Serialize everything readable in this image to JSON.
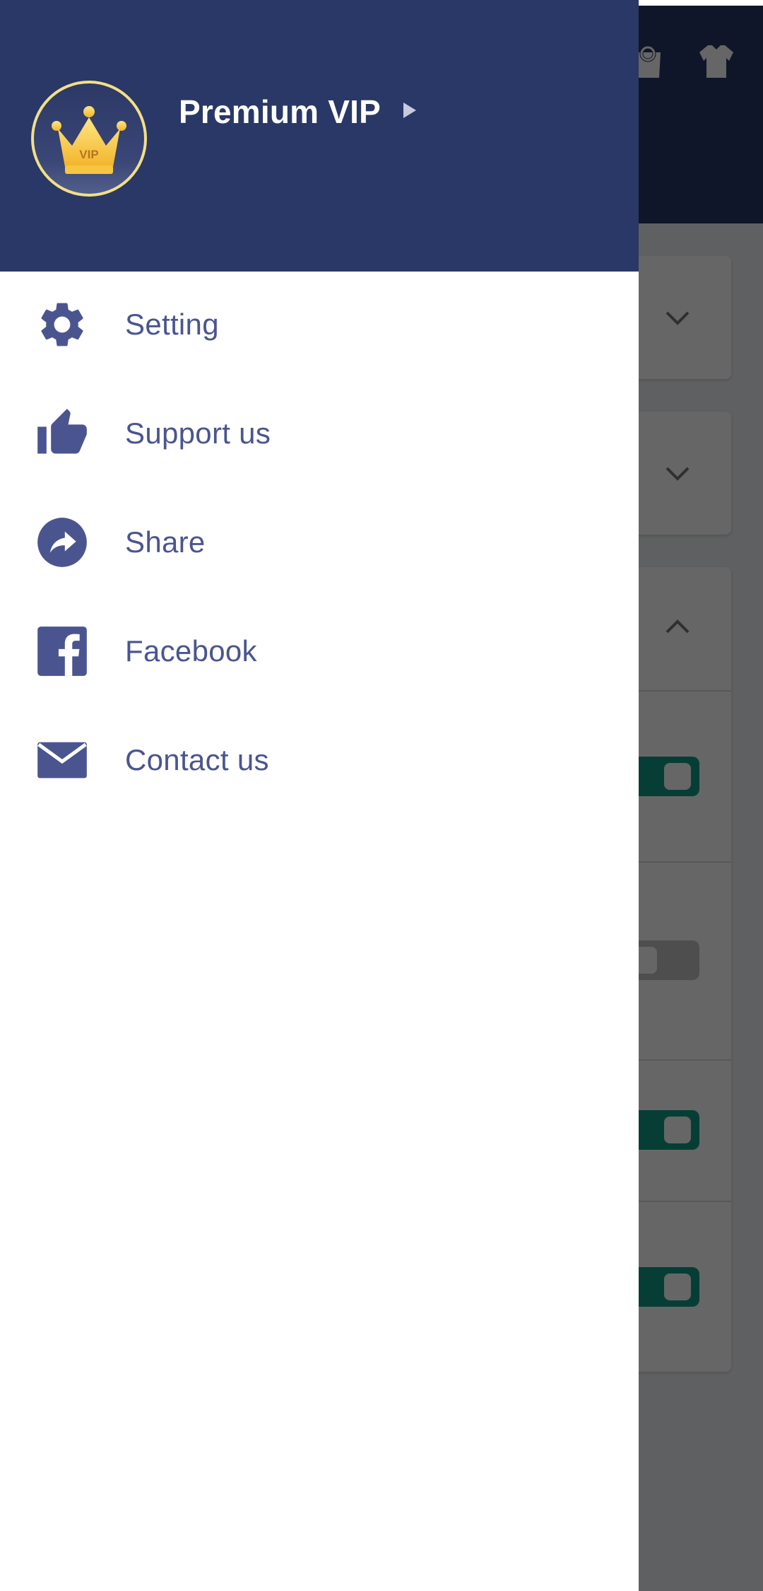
{
  "drawer": {
    "header": {
      "title": "Premium VIP",
      "badge_text": "VIP"
    },
    "menu_items": [
      {
        "label": "Setting",
        "icon": "gear-icon"
      },
      {
        "label": "Support us",
        "icon": "thumbs-up-icon"
      },
      {
        "label": "Share",
        "icon": "share-icon"
      },
      {
        "label": "Facebook",
        "icon": "facebook-icon"
      },
      {
        "label": "Contact us",
        "icon": "mail-icon"
      }
    ]
  },
  "background_app": {
    "toolbar_icons": [
      "bag-icon",
      "shirt-icon"
    ],
    "toggles": [
      {
        "state": "on"
      },
      {
        "state": "off"
      },
      {
        "state": "on"
      },
      {
        "state": "on"
      }
    ]
  },
  "colors": {
    "drawer_header": "#293866",
    "menu_text": "#4a5590",
    "toggle_on": "#0f9b86",
    "vip_gold": "#f3df87"
  }
}
